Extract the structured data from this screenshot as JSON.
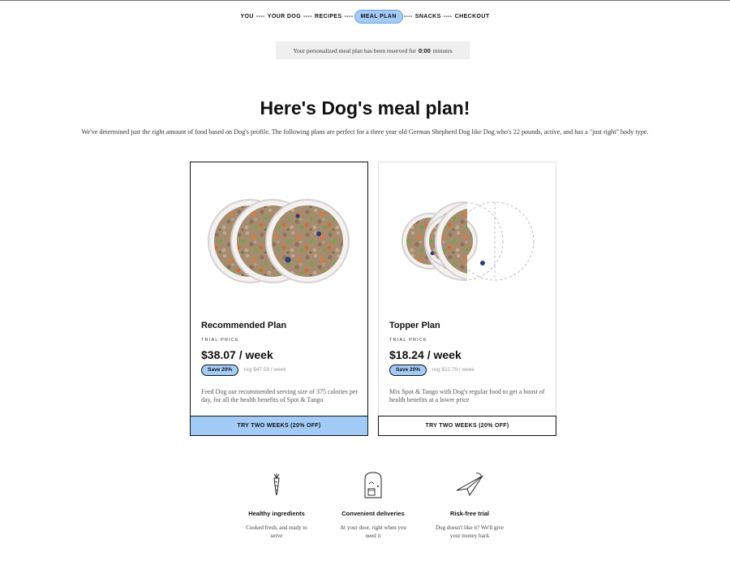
{
  "progress": {
    "steps": [
      "YOU",
      "YOUR DOG",
      "RECIPES",
      "MEAL PLAN",
      "SNACKS",
      "CHECKOUT"
    ],
    "separator": "----",
    "active_step": "MEAL PLAN"
  },
  "banner": {
    "text_before": "Your personalized meal plan has been reserved for",
    "timer": "0:00",
    "text_after": "minutes"
  },
  "page_title": "Here's Dog's meal plan!",
  "intro": "We've determined just the right amount of food based on Dog's profile. The following plans are perfect for a three year old German Shepherd Dog like Dog who's 22 pounds, active, and has a \"just right\" body type.",
  "plans": [
    {
      "name": "Recommended Plan",
      "trial_label": "TRIAL PRICE",
      "price": "$38.07 / week",
      "badge": "Save 20%",
      "regular": "reg $47.59 / week",
      "description": "Feed Dog our recommended serving size of 375 calories per day, for all the health benefits of Spot & Tango",
      "button": "TRY TWO WEEKS (20% OFF)",
      "selected": true
    },
    {
      "name": "Topper Plan",
      "trial_label": "TRIAL PRICE",
      "price": "$18.24 / week",
      "badge": "Save 20%",
      "regular": "reg $22.79 / week",
      "description": "Mix Spot & Tango with Dog's regular food to get a boost of health benefits at a lower price",
      "button": "TRY TWO WEEKS (20% OFF)",
      "selected": false
    }
  ],
  "benefits": [
    {
      "icon": "carrot-icon",
      "title": "Healthy ingredients",
      "description": "Cooked fresh, and ready to serve"
    },
    {
      "icon": "dog-door-icon",
      "title": "Convenient deliveries",
      "description": "At your door, right when you need it"
    },
    {
      "icon": "paper-plane-icon",
      "title": "Risk-free trial",
      "description": "Dog doesn't like it? We'll give your money back"
    }
  ],
  "colors": {
    "accent": "#a3cbf7",
    "text": "#111111",
    "muted": "#999999"
  }
}
